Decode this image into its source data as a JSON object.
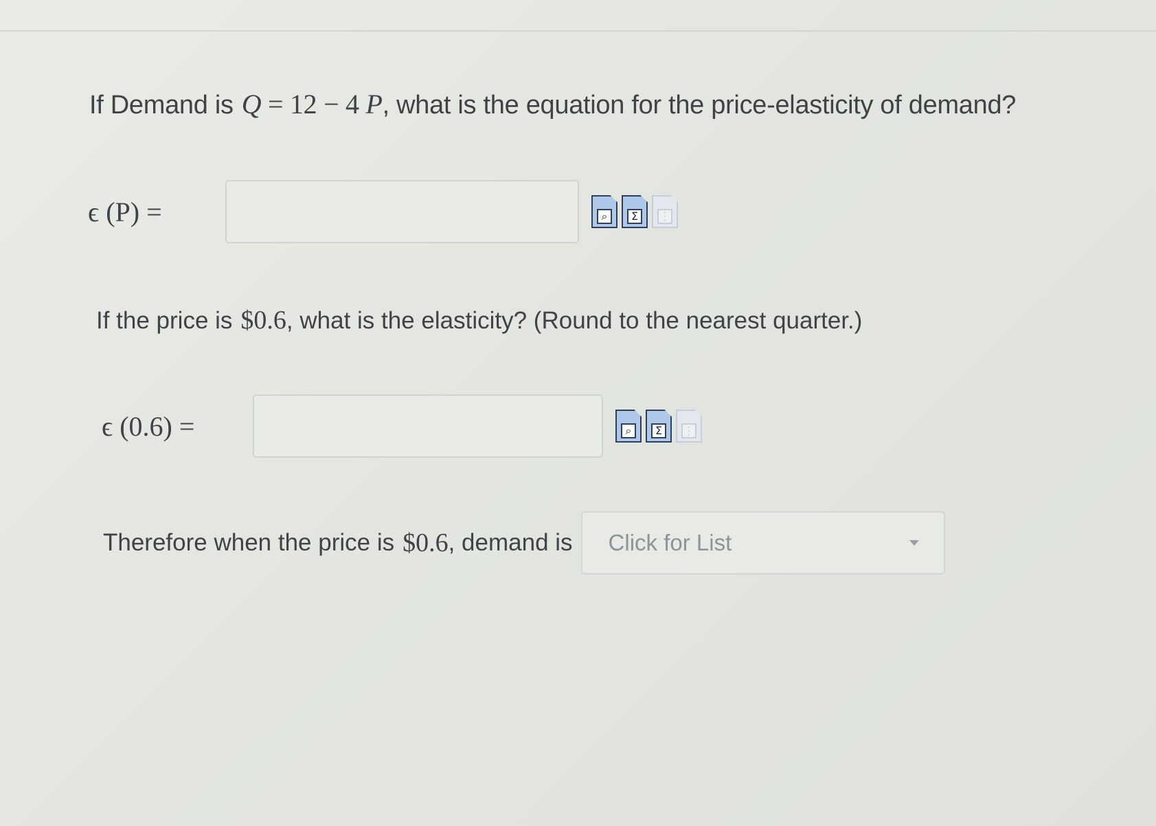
{
  "question1": {
    "prefix": "If Demand is",
    "eq_q": "Q",
    "eq_rest": "= 12 − 4",
    "eq_p": "P",
    "suffix": ", what is the equation for the price-elasticity of demand?"
  },
  "answer1": {
    "label": "ϵ (P) =",
    "value": "",
    "placeholder": ""
  },
  "question2": {
    "prefix": "If the price is",
    "price": "$0.6",
    "suffix": ", what is the elasticity? (Round to the nearest quarter.)"
  },
  "answer2": {
    "label": "ϵ (0.6) =",
    "value": "",
    "placeholder": ""
  },
  "conclusion": {
    "prefix": "Therefore when the price is",
    "price": "$0.6",
    "suffix": ", demand is",
    "dropdown_label": "Click for List"
  },
  "tools": {
    "preview_icon": "preview-icon",
    "equation_editor_icon": "equation-editor-icon",
    "keypad_icon": "keypad-icon"
  },
  "colors": {
    "background": "#e6e9e3",
    "text": "#3f4348",
    "icon_fill": "#aec8ea",
    "icon_border": "#2f3f5c"
  }
}
